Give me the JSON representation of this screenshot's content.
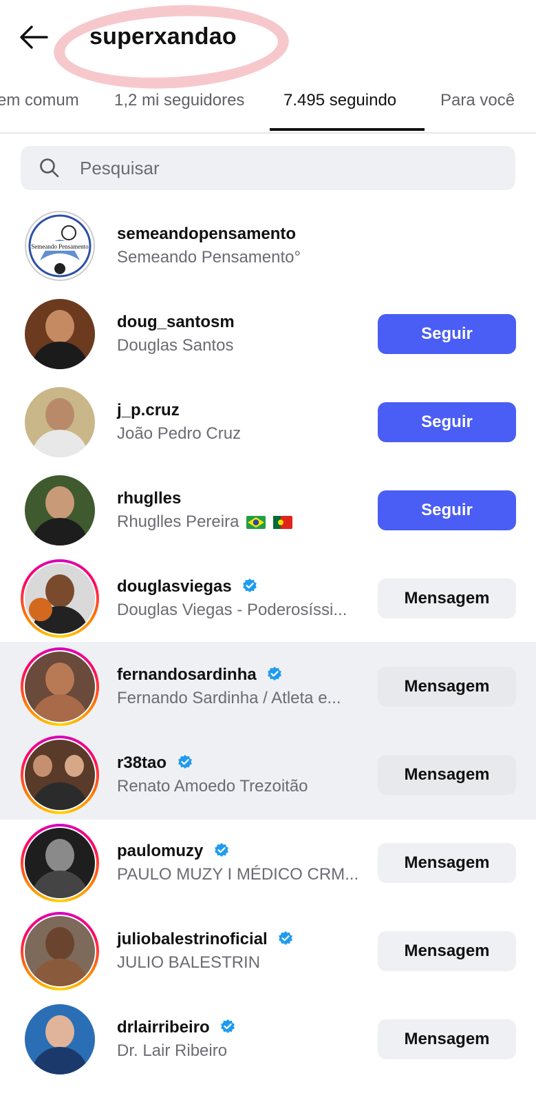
{
  "header": {
    "title": "superxandao",
    "back_icon": "arrow-left-icon"
  },
  "tabs": [
    {
      "label": "em comum",
      "active": false
    },
    {
      "label": "1,2 mi seguidores",
      "active": false
    },
    {
      "label": "7.495 seguindo",
      "active": true
    },
    {
      "label": "Para você",
      "active": false
    }
  ],
  "search": {
    "placeholder": "Pesquisar",
    "icon": "search-icon"
  },
  "colors": {
    "follow_button": "#4a5df5",
    "message_button": "#eff0f3",
    "verified": "#1f9bf0",
    "annotation": "#f5c2c7"
  },
  "accounts": [
    {
      "username": "semeandopensamento",
      "full_name": "Semeando Pensamento°",
      "verified": false,
      "story_ring": false,
      "button": "",
      "logo_text": "Semeando Pensamento"
    },
    {
      "username": "doug_santosm",
      "full_name": "Douglas Santos",
      "verified": false,
      "story_ring": false,
      "button": "Seguir"
    },
    {
      "username": "j_p.cruz",
      "full_name": "João Pedro Cruz",
      "verified": false,
      "story_ring": false,
      "button": "Seguir"
    },
    {
      "username": "rhuglles",
      "full_name": "Rhuglles Pereira",
      "flags": [
        "flag-brazil-icon",
        "flag-portugal-icon"
      ],
      "verified": false,
      "story_ring": false,
      "button": "Seguir"
    },
    {
      "username": "douglasviegas",
      "full_name": "Douglas Viegas - Poderosíssi...",
      "verified": true,
      "story_ring": true,
      "button": "Mensagem"
    },
    {
      "username": "fernandosardinha",
      "full_name": "Fernando Sardinha / Atleta e...",
      "verified": true,
      "story_ring": true,
      "button": "Mensagem"
    },
    {
      "username": "r38tao",
      "full_name": "Renato Amoedo Trezoitão",
      "verified": true,
      "story_ring": true,
      "button": "Mensagem"
    },
    {
      "username": "paulomuzy",
      "full_name": "PAULO MUZY I MÉDICO CRM...",
      "verified": true,
      "story_ring": true,
      "button": "Mensagem"
    },
    {
      "username": "juliobalestrinoficial",
      "full_name": "JULIO BALESTRIN",
      "verified": true,
      "story_ring": true,
      "button": "Mensagem"
    },
    {
      "username": "drlairribeiro",
      "full_name": "Dr. Lair Ribeiro",
      "verified": true,
      "story_ring": false,
      "button": "Mensagem"
    }
  ]
}
